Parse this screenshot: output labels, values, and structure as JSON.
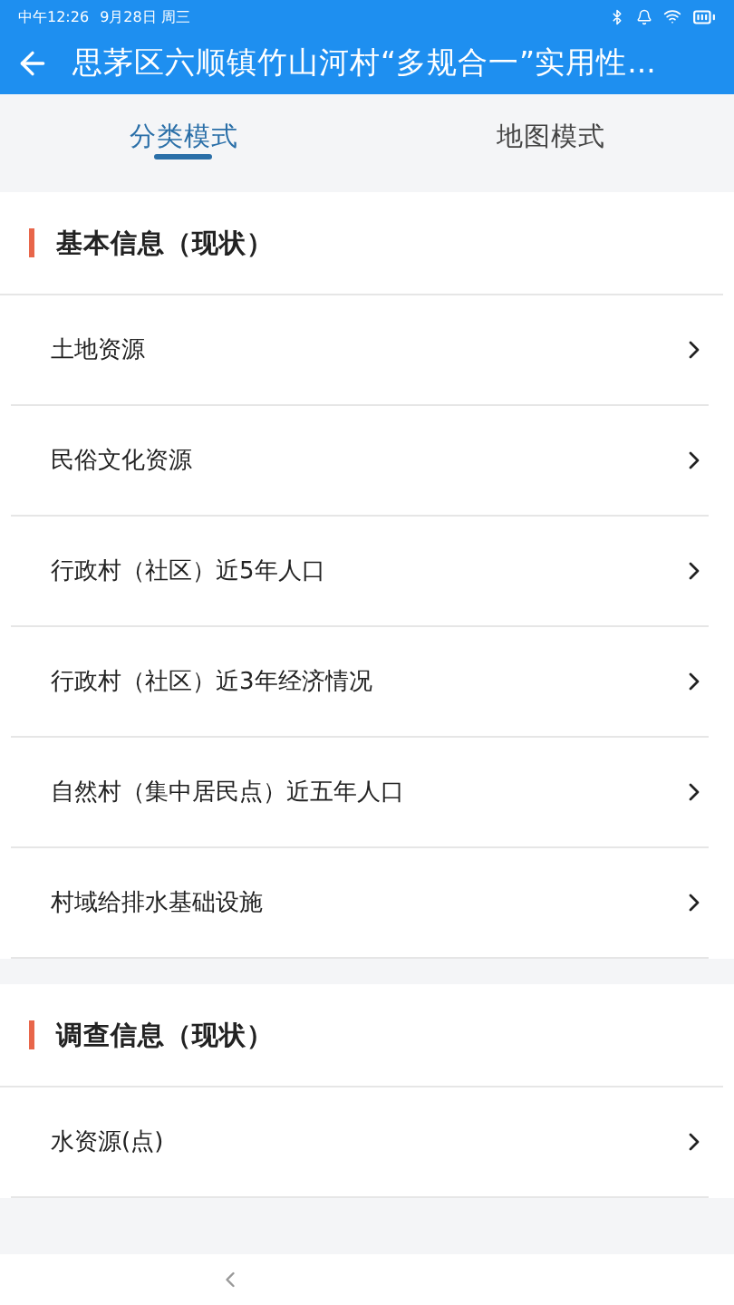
{
  "status_bar": {
    "time": "中午12:26",
    "date": "9月28日 周三"
  },
  "header": {
    "title": "思茅区六顺镇竹山河村“多规合一”实用性..."
  },
  "tabs": [
    {
      "label": "分类模式",
      "selected": true
    },
    {
      "label": "地图模式",
      "selected": false
    }
  ],
  "sections": [
    {
      "title": "基本信息（现状）",
      "items": [
        "土地资源",
        "民俗文化资源",
        "行政村（社区）近5年人口",
        "行政村（社区）近3年经济情况",
        "自然村（集中居民点）近五年人口",
        "村域给排水基础设施"
      ]
    },
    {
      "title": "调查信息（现状）",
      "items": [
        "水资源(点)"
      ]
    }
  ]
}
